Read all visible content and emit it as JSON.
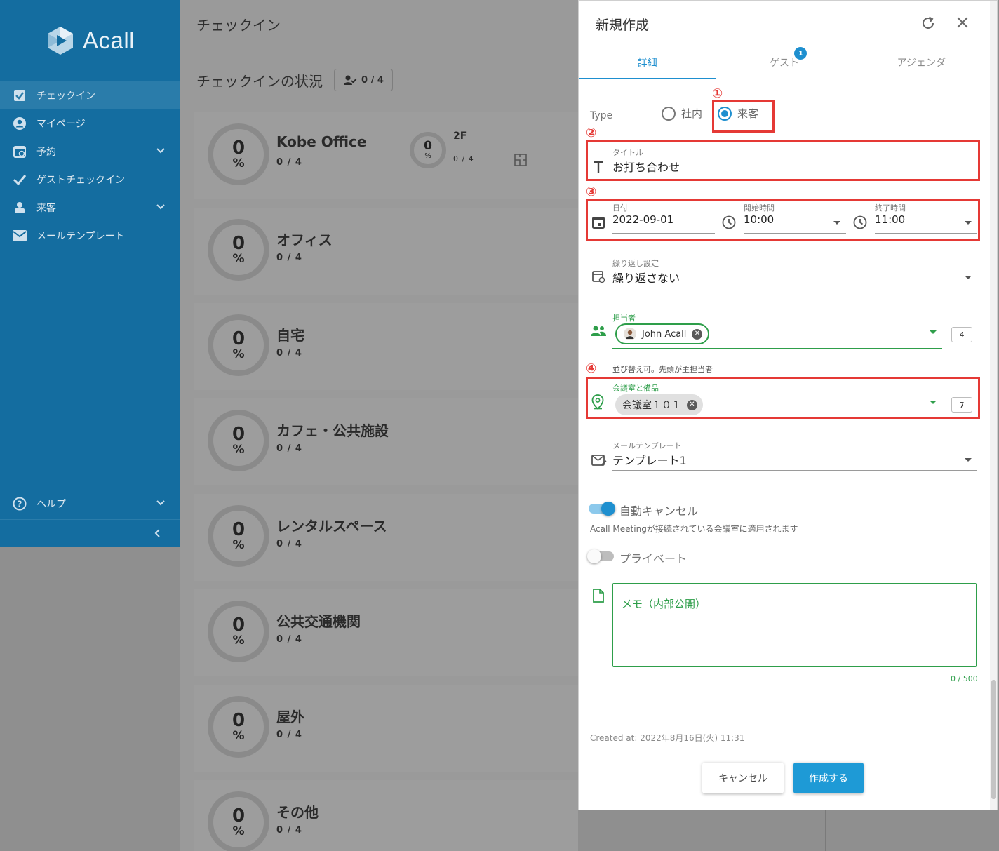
{
  "sidebar": {
    "brand": "Acall",
    "items": [
      {
        "label": "チェックイン",
        "icon": "checkbox-icon"
      },
      {
        "label": "マイページ",
        "icon": "account-icon"
      },
      {
        "label": "予約",
        "icon": "calendar-icon"
      },
      {
        "label": "ゲストチェックイン",
        "icon": "check-icon"
      },
      {
        "label": "来客",
        "icon": "visitor-icon"
      },
      {
        "label": "メールテンプレート",
        "icon": "mail-icon"
      }
    ],
    "help_label": "ヘルプ"
  },
  "main": {
    "page_title": "チェックイン",
    "status_title": "チェックインの状況",
    "status_badge": "0 / 4",
    "locations": [
      {
        "name": "Kobe Office",
        "percent": "0",
        "unit": "%",
        "count": "0 / 4",
        "sub": {
          "name": "2F",
          "percent": "0",
          "unit": "%",
          "count": "0 / 4"
        }
      },
      {
        "name": "オフィス",
        "percent": "0",
        "unit": "%",
        "count": "0 / 4"
      },
      {
        "name": "自宅",
        "percent": "0",
        "unit": "%",
        "count": "0 / 4"
      },
      {
        "name": "カフェ・公共施設",
        "percent": "0",
        "unit": "%",
        "count": "0 / 4"
      },
      {
        "name": "レンタルスペース",
        "percent": "0",
        "unit": "%",
        "count": "0 / 4"
      },
      {
        "name": "公共交通機関",
        "percent": "0",
        "unit": "%",
        "count": "0 / 4"
      },
      {
        "name": "屋外",
        "percent": "0",
        "unit": "%",
        "count": "0 / 4"
      },
      {
        "name": "その他",
        "percent": "0",
        "unit": "%",
        "count": "0 / 4"
      }
    ]
  },
  "dialog": {
    "title": "新規作成",
    "tabs": [
      "詳細",
      "ゲスト",
      "アジェンダ"
    ],
    "guest_badge": "1",
    "markers": [
      "①",
      "②",
      "③",
      "④"
    ],
    "type_label": "Type",
    "type_options": [
      "社内",
      "来客"
    ],
    "type_selected": "来客",
    "title_field": {
      "label": "タイトル",
      "value": "お打ち合わせ"
    },
    "date_field": {
      "label": "日付",
      "value": "2022-09-01"
    },
    "start_field": {
      "label": "開始時間",
      "value": "10:00"
    },
    "end_field": {
      "label": "終了時間",
      "value": "11:00"
    },
    "repeat_field": {
      "label": "繰り返し設定",
      "value": "繰り返さない"
    },
    "host_field": {
      "label": "担当者",
      "chip": "John Acall",
      "count": "4"
    },
    "host_hint": "並び替え可。先頭が主担当者",
    "room_field": {
      "label": "会議室と備品",
      "chip": "会議室１０１",
      "count": "7"
    },
    "mail_field": {
      "label": "メールテンプレート",
      "value": "テンプレート1"
    },
    "auto_cancel": {
      "label": "自動キャンセル",
      "on": true,
      "note": "Acall Meetingが接続されている会議室に適用されます"
    },
    "private": {
      "label": "プライベート",
      "on": false
    },
    "memo": {
      "placeholder": "メモ（内部公開）",
      "counter": "0 / 500"
    },
    "created": "Created at: 2022年8月16日(火) 11:31",
    "cancel_label": "キャンセル",
    "create_label": "作成する"
  },
  "colors": {
    "sidebar": "#146da0",
    "accent": "#1e8fcf",
    "green": "#2e9e4a",
    "red": "#e53935"
  }
}
